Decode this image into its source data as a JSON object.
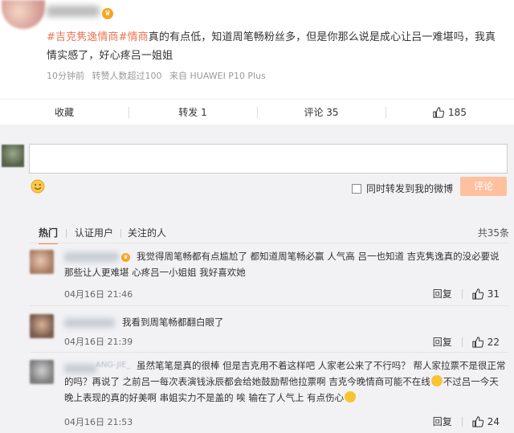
{
  "post": {
    "tag1": "#吉克隽逸情商",
    "tag2": "#情商",
    "body": "真的有点低，知道周笔畅粉丝多，但是你那么说是成心让吕一难堪吗，我真情实感了，好心疼吕一姐姐",
    "vip_glyph": "♛",
    "meta": {
      "time": "10分钟前",
      "forward_note": "转赞人数超过100",
      "source": "来自 HUAWEI P10 Plus"
    }
  },
  "actions": {
    "favorite": "收藏",
    "forward": "转发 1",
    "comment": "评论 35",
    "like_count": "185"
  },
  "reply_box": {
    "forward_option": "同时转发到我的微博",
    "submit": "评论"
  },
  "filters": {
    "tabs": [
      "热门",
      "认证用户",
      "关注的人"
    ],
    "total": "共35条"
  },
  "comments": [
    {
      "text": "我觉得周笔畅都有点尴尬了 都知道周笔畅必赢 人气高 吕一也知道 吉克隽逸真的没必要说那些让人更难堪 心疼吕一小姐姐 我好喜欢她",
      "time": "04月16日 21:46",
      "reply": "回复",
      "likes": "31"
    },
    {
      "text": "我看到周笔畅都翻白眼了",
      "time": "04月16日 21:39",
      "reply": "回复",
      "likes": "22"
    },
    {
      "name_fragment": "ANG-JIE_",
      "text_a": "虽然笔笔是真的很棒 但是吉克用不着这样吧 人家老公来了不行吗？ 帮人家拉票不是很正常的吗？再说了 之前吕一每次表演钱泳辰都会给她鼓励帮他拉票啊 吉克今晚情商可能不在线",
      "text_b": "不过吕一今天晚上表现的真的好美啊 串姐实力不是盖的 唉 输在了人气上 有点伤心",
      "time": "04月16日 21:53",
      "reply": "回复",
      "likes": "24"
    }
  ],
  "colors": {
    "accent": "#eb7350",
    "submit_disabled": "#ffc09f",
    "tab_underline": "#fa7d3c"
  }
}
